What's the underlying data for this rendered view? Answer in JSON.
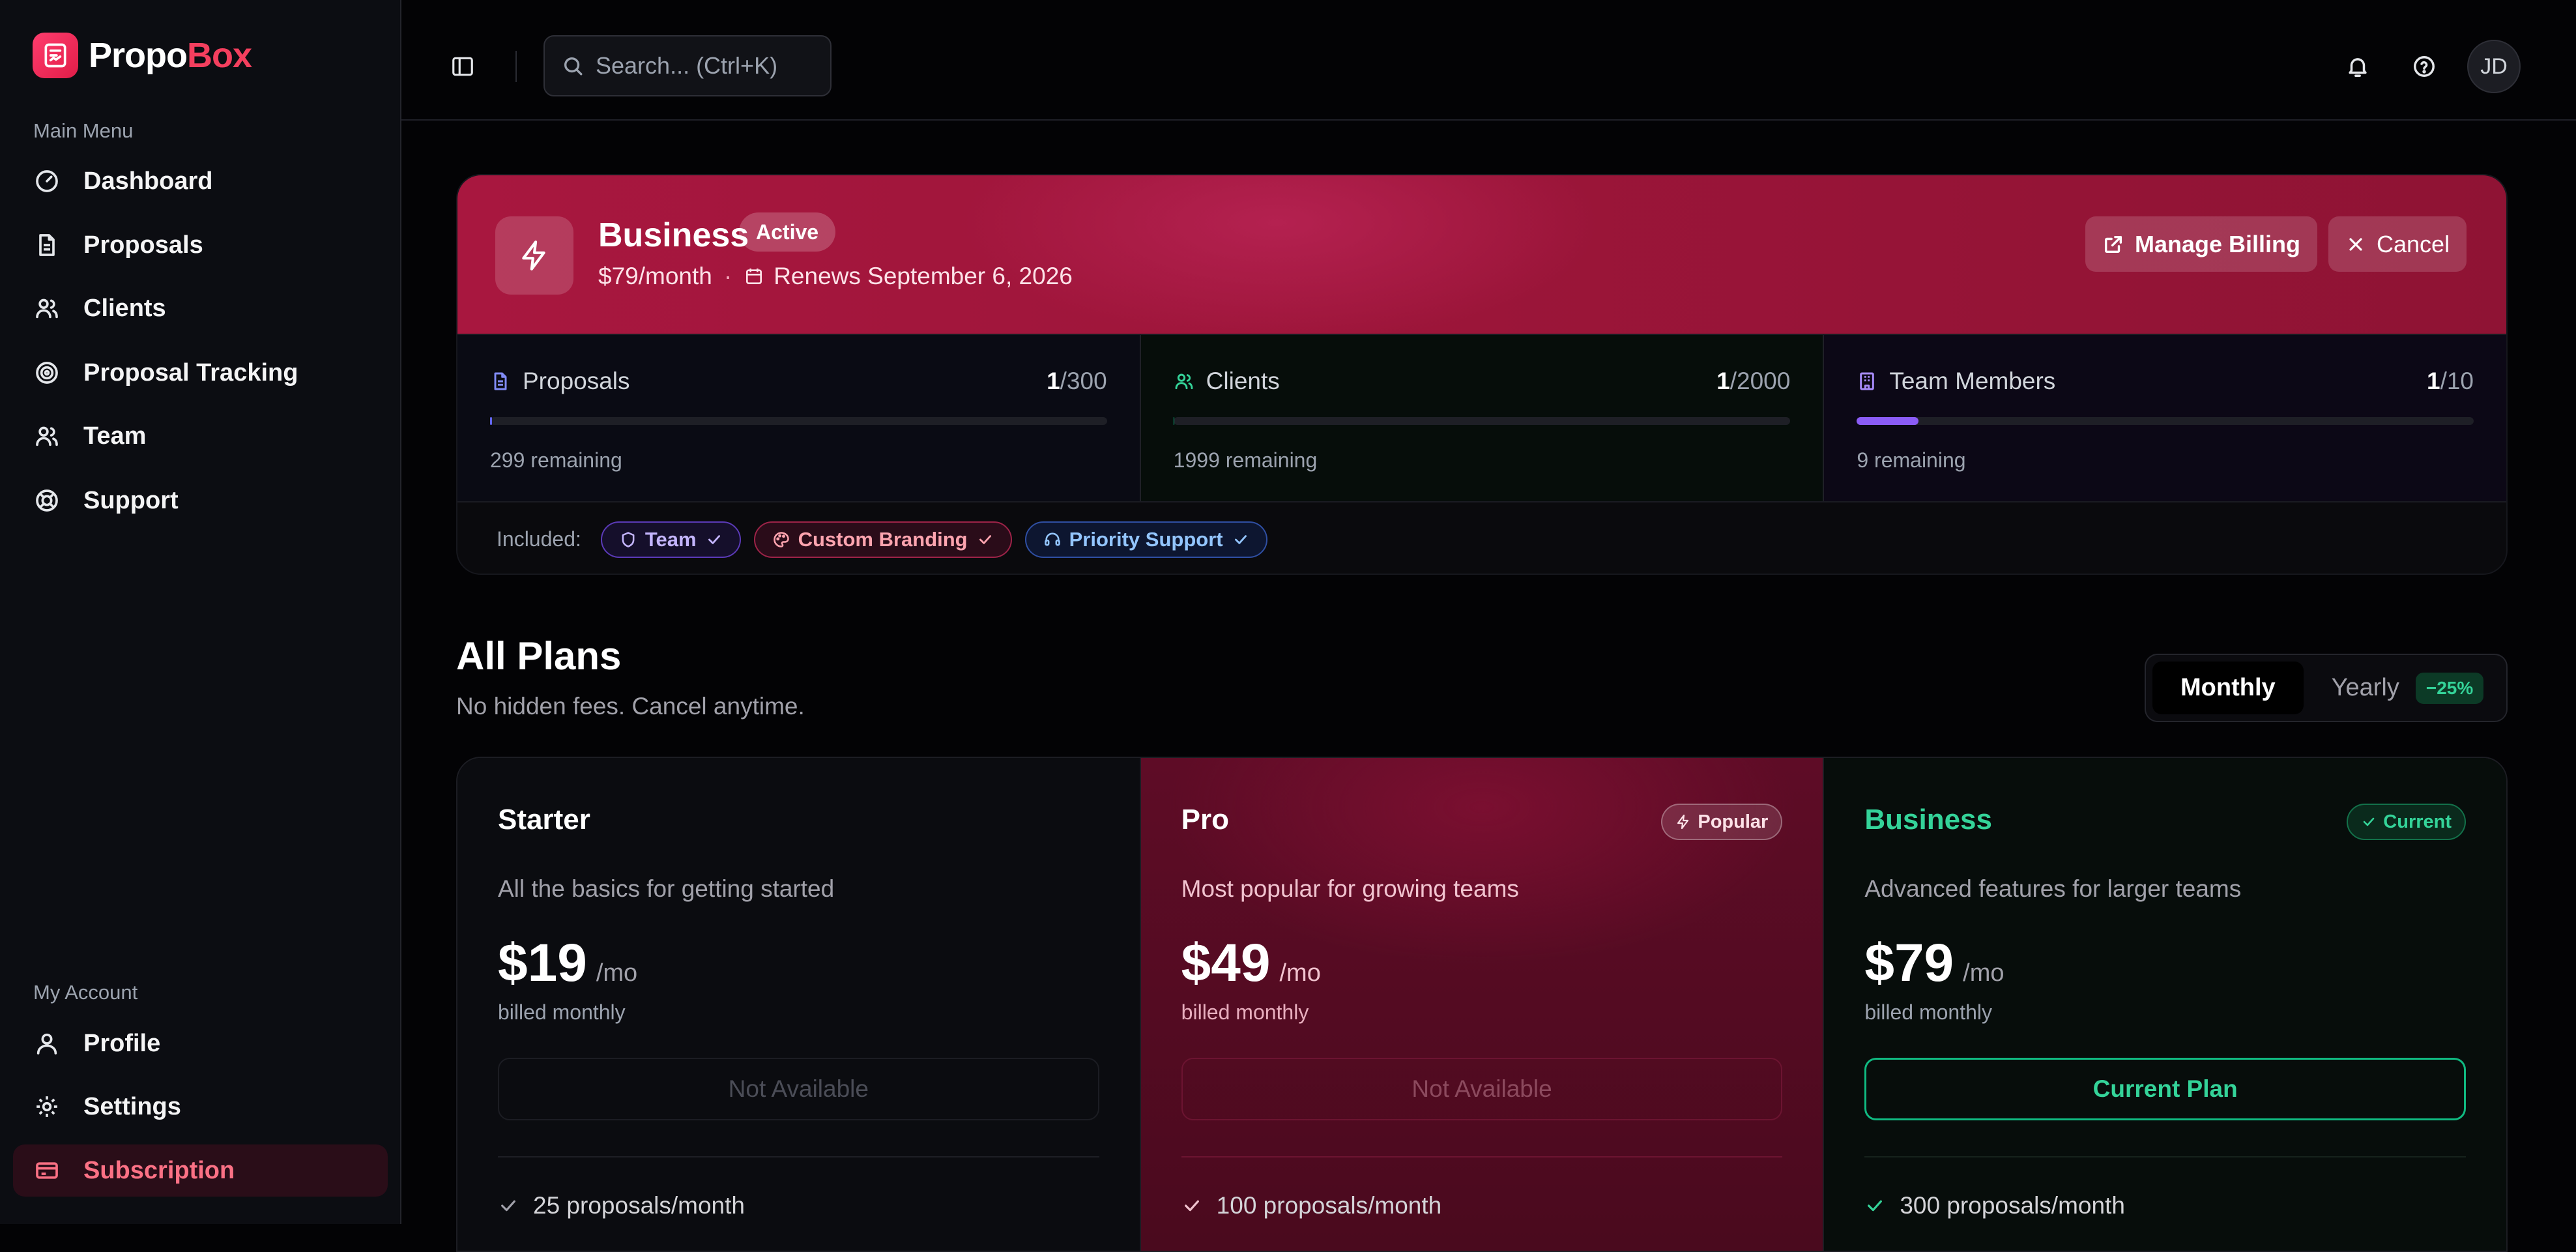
{
  "app": {
    "logo_part1": "Propo",
    "logo_part2": "Box",
    "brand_color": "#f43f5e"
  },
  "sidebar": {
    "main_menu_label": "Main Menu",
    "main_items": [
      {
        "label": "Dashboard",
        "icon": "gauge-icon"
      },
      {
        "label": "Proposals",
        "icon": "document-icon"
      },
      {
        "label": "Clients",
        "icon": "users-icon"
      },
      {
        "label": "Proposal Tracking",
        "icon": "target-icon"
      },
      {
        "label": "Team",
        "icon": "users-icon"
      },
      {
        "label": "Support",
        "icon": "lifebuoy-icon"
      }
    ],
    "account_label": "My Account",
    "account_items": [
      {
        "label": "Profile",
        "icon": "user-icon"
      },
      {
        "label": "Settings",
        "icon": "gear-icon"
      },
      {
        "label": "Subscription",
        "icon": "credit-card-icon",
        "active": true
      }
    ]
  },
  "topbar": {
    "search_placeholder": "Search... (Ctrl+K)",
    "avatar_initials": "JD"
  },
  "subscription": {
    "plan_name": "Business",
    "status": "Active",
    "price": "$79/month",
    "separator": "·",
    "renews": "Renews September 6, 2026",
    "manage_billing_label": "Manage Billing",
    "cancel_label": "Cancel",
    "usage": [
      {
        "label": "Proposals",
        "used": "1",
        "limit": "/300",
        "remaining": "299 remaining",
        "fraction": 0.0033,
        "color": "#6366f1"
      },
      {
        "label": "Clients",
        "used": "1",
        "limit": "/2000",
        "remaining": "1999 remaining",
        "fraction": 0.0005,
        "color": "#10b981"
      },
      {
        "label": "Team Members",
        "used": "1",
        "limit": "/10",
        "remaining": "9 remaining",
        "fraction": 0.1,
        "color": "#8b5cf6"
      }
    ],
    "included_label": "Included:",
    "included": [
      "Team",
      "Custom Branding",
      "Priority Support"
    ]
  },
  "plans_section": {
    "title": "All Plans",
    "subtitle": "No hidden fees. Cancel anytime.",
    "toggle_monthly": "Monthly",
    "toggle_yearly": "Yearly",
    "yearly_discount": "−25%"
  },
  "plans": [
    {
      "name": "Starter",
      "description": "All the basics for getting started",
      "price": "$19",
      "period": "/mo",
      "billed": "billed monthly",
      "button": "Not Available",
      "feature": "25 proposals/month"
    },
    {
      "name": "Pro",
      "badge": "Popular",
      "description": "Most popular for growing teams",
      "price": "$49",
      "period": "/mo",
      "billed": "billed monthly",
      "button": "Not Available",
      "feature": "100 proposals/month"
    },
    {
      "name": "Business",
      "badge": "Current",
      "description": "Advanced features for larger teams",
      "price": "$79",
      "period": "/mo",
      "billed": "billed monthly",
      "button": "Current Plan",
      "feature": "300 proposals/month"
    }
  ]
}
